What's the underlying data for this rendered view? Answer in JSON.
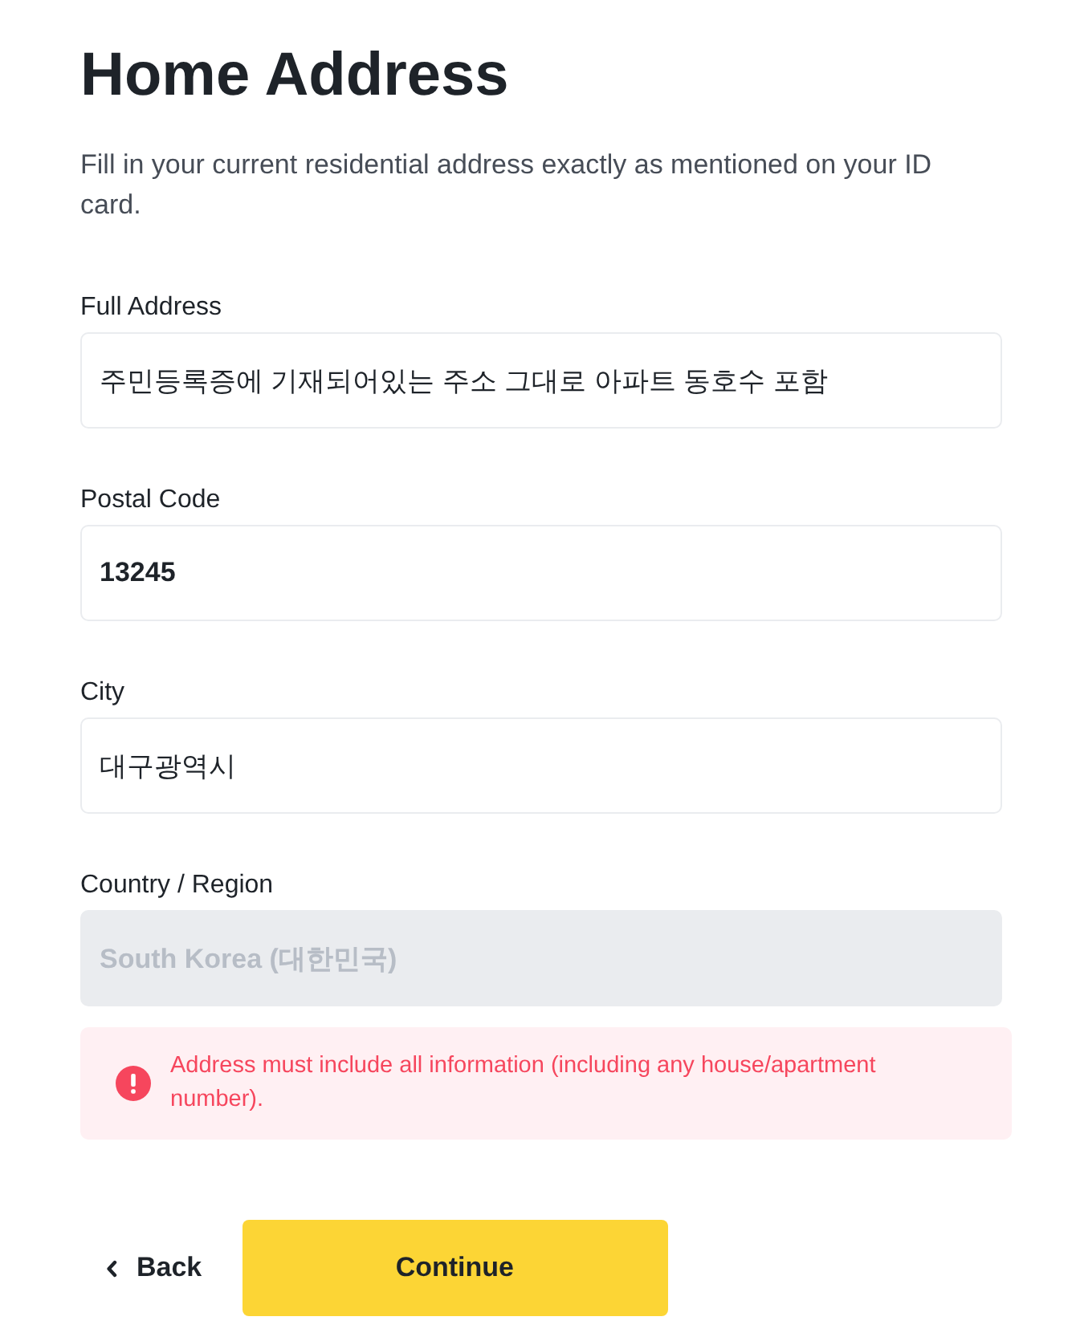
{
  "title": "Home Address",
  "description": "Fill in your current residential address exactly as mentioned on your ID card.",
  "fields": [
    {
      "label": "Full Address",
      "value": "주민등록증에 기재되어있는 주소 그대로 아파트 동호수 포함",
      "kind": "text",
      "disabled": false
    },
    {
      "label": "Postal Code",
      "value": "13245",
      "kind": "numeric",
      "disabled": false
    },
    {
      "label": "City",
      "value": "대구광역시",
      "kind": "text",
      "disabled": false
    },
    {
      "label": "Country / Region",
      "value": "South Korea (대한민국)",
      "kind": "text",
      "disabled": true
    }
  ],
  "error": {
    "message": "Address must include all information (including any house/apartment number)."
  },
  "actions": {
    "back": "Back",
    "continue": "Continue"
  }
}
